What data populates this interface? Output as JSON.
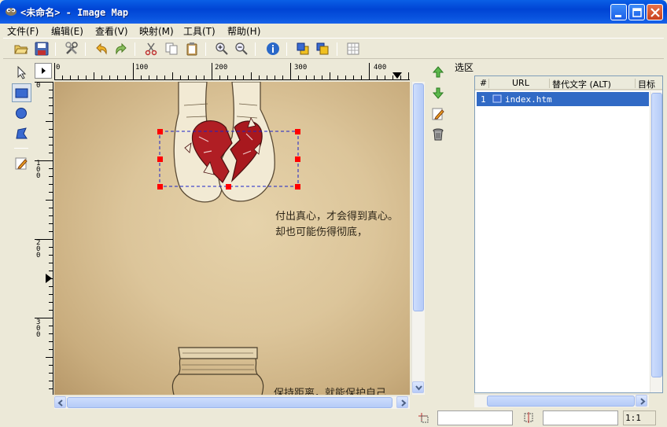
{
  "window": {
    "title": "<未命名> - Image Map"
  },
  "menu": [
    {
      "label": "文件(F)"
    },
    {
      "label": "编辑(E)"
    },
    {
      "label": "查看(V)"
    },
    {
      "label": "映射(M)"
    },
    {
      "label": "工具(T)"
    },
    {
      "label": "帮助(H)"
    }
  ],
  "toolbar": {
    "icons": [
      "open-icon",
      "save-icon",
      "preferences-icon",
      "undo-icon",
      "redo-icon",
      "cut-icon",
      "copy-icon",
      "paste-icon",
      "zoom-in-icon",
      "zoom-out-icon",
      "info-icon",
      "to-front-icon",
      "to-back-icon",
      "grid-icon"
    ]
  },
  "palette": {
    "tools": [
      "arrow-icon",
      "rectangle-icon",
      "circle-icon",
      "polygon-icon",
      "edit-icon"
    ],
    "active": "rectangle-icon"
  },
  "rulers": {
    "h_labels": [
      "0",
      "100",
      "200",
      "300",
      "400"
    ],
    "v_labels": [
      "0",
      "100",
      "200",
      "300"
    ]
  },
  "canvas": {
    "caption1_line1": "付出真心，才会得到真心。",
    "caption1_line2": "却也可能伤得彻底，",
    "caption2": "保持距离，就能保护自己"
  },
  "selection": {
    "title": "选区",
    "columns": [
      "#",
      "URL",
      "替代文字 (ALT)",
      "目标"
    ],
    "rows": [
      {
        "num": "1",
        "url": "index.htm"
      }
    ]
  },
  "statusbar": {
    "zoom": "1:1"
  },
  "colors": {
    "selection_handle": "#ff0000",
    "selection_row": "#316ac5",
    "heart": "#b01e24"
  }
}
